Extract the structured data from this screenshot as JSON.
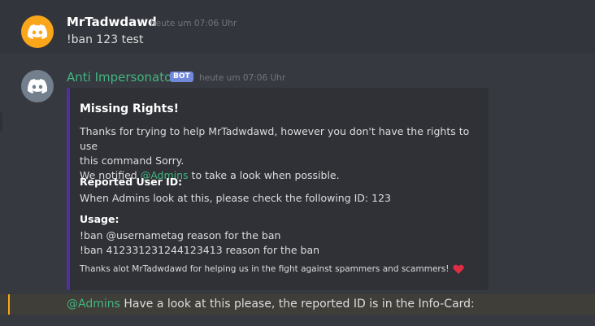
{
  "messages": [
    {
      "author": "MrTadwdawd",
      "timestamp": "heute um 07:06 Uhr",
      "content": "!ban 123 test",
      "avatar_icon": "discord-logo-icon",
      "avatar_color": "#faa61a"
    },
    {
      "author": "Anti Impersonator",
      "badge": "BOT",
      "timestamp": "heute um 07:06 Uhr",
      "avatar_icon": "discord-logo-icon",
      "avatar_color": "#747f8d",
      "embed": {
        "accent_color": "#4f2fa4",
        "title": "Missing Rights!",
        "description_line1": "Thanks for trying to help MrTadwdawd, however you don't have the rights to use",
        "description_line2": "this command Sorry.",
        "description_line3_prefix": "We notified ",
        "description_line3_mention": "@Admins",
        "description_line3_suffix": " to take a look when possible.",
        "fields": [
          {
            "name": "Reported User ID:",
            "value": "When Admins look at this, please check the following ID: 123"
          },
          {
            "name": "Usage:",
            "value_line1": "!ban @usernametag reason for the ban",
            "value_line2": "!ban 412331231244123413 reason for the ban"
          }
        ],
        "footer": "Thanks alot MrTadwdawd for helping us in the fight against spammers and scammers!",
        "footer_icon": "red-heart-icon"
      }
    }
  ],
  "pending_message": {
    "mention": "@Admins",
    "text": " Have a look at this please, the reported ID is in the Info-Card:",
    "highlight_color": "#faa61a"
  }
}
